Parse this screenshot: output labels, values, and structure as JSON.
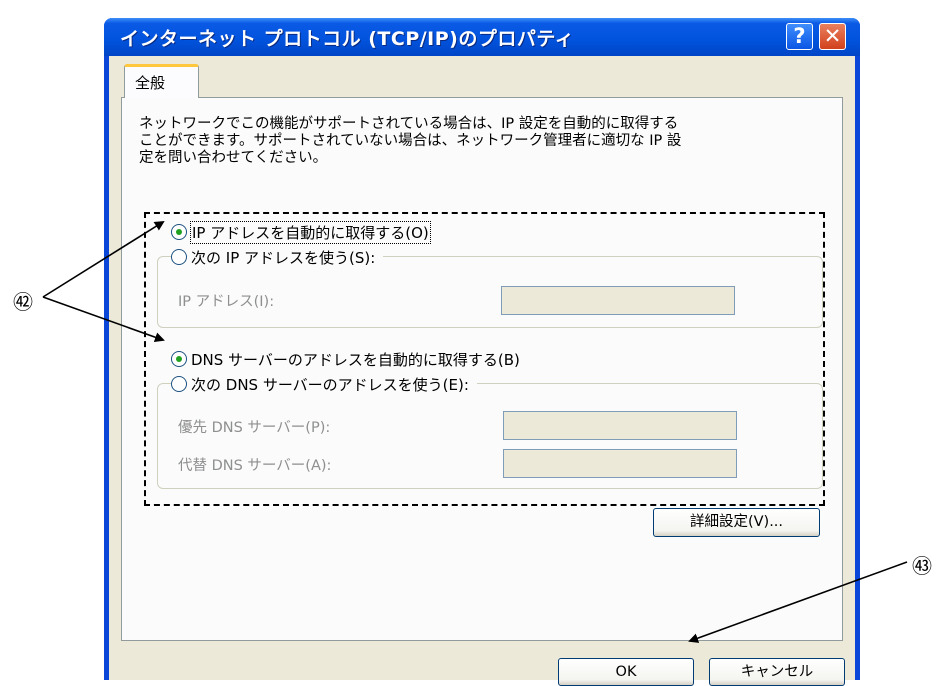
{
  "window": {
    "title": "インターネット プロトコル (TCP/IP)のプロパティ"
  },
  "titlebar_buttons": {
    "help": "?",
    "close": "✕"
  },
  "tabs": [
    {
      "label": "全般"
    }
  ],
  "description": [
    "ネットワークでこの機能がサポートされている場合は、IP 設定を自動的に取得する",
    "ことができます。サポートされていない場合は、ネットワーク管理者に適切な IP 設",
    "定を問い合わせてください。"
  ],
  "ip": {
    "auto_label": "IP アドレスを自動的に取得する(O)",
    "manual_label": "次の IP アドレスを使う(S):",
    "selected": "auto",
    "address_label": "IP アドレス(I):",
    "address_value": ""
  },
  "dns": {
    "auto_label": "DNS サーバーのアドレスを自動的に取得する(B)",
    "manual_label": "次の DNS サーバーのアドレスを使う(E):",
    "selected": "auto",
    "preferred_label": "優先 DNS サーバー(P):",
    "preferred_value": "",
    "alternate_label": "代替 DNS サーバー(A):",
    "alternate_value": ""
  },
  "buttons": {
    "advanced": "詳細設定(V)...",
    "ok": "OK",
    "cancel": "キャンセル"
  },
  "callouts": {
    "c52": "㊷",
    "c53": "㊸"
  },
  "colors": {
    "titlebar": "#0152dc",
    "radio_dot": "#21a121",
    "tab_accent": "#ffc83c"
  }
}
